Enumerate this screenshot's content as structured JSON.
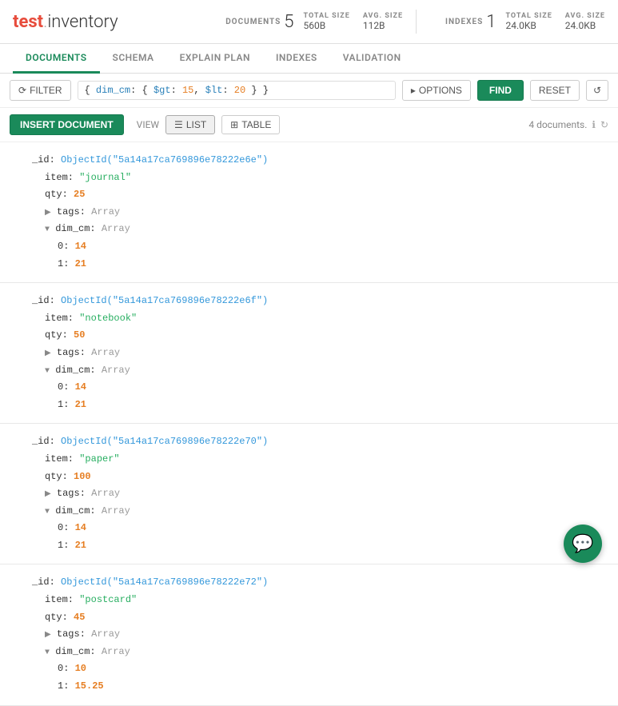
{
  "header": {
    "logo_test": "test",
    "logo_dot": ".",
    "logo_inventory": "inventory",
    "docs_label": "DOCUMENTS",
    "docs_count": "5",
    "docs_total_size_label": "TOTAL SIZE",
    "docs_total_size": "560B",
    "docs_avg_size_label": "AVG. SIZE",
    "docs_avg_size": "112B",
    "indexes_label": "INDEXES",
    "indexes_count": "1",
    "indexes_total_size_label": "TOTAL SIZE",
    "indexes_total_size": "24.0KB",
    "indexes_avg_size_label": "AVG. SIZE",
    "indexes_avg_size": "24.0KB"
  },
  "nav": {
    "tabs": [
      {
        "id": "documents",
        "label": "DOCUMENTS",
        "active": true
      },
      {
        "id": "schema",
        "label": "SCHEMA",
        "active": false
      },
      {
        "id": "explain-plan",
        "label": "EXPLAIN PLAN",
        "active": false
      },
      {
        "id": "indexes",
        "label": "INDEXES",
        "active": false
      },
      {
        "id": "validation",
        "label": "VALIDATION",
        "active": false
      }
    ]
  },
  "toolbar": {
    "filter_label": "FILTER",
    "filter_query": "{ dim_cm: { $gt: 15, $lt: 20 } }",
    "options_label": "▸ OPTIONS",
    "find_label": "FIND",
    "reset_label": "RESET"
  },
  "action_bar": {
    "insert_label": "INSERT DOCUMENT",
    "view_label": "VIEW",
    "list_label": "LIST",
    "table_label": "TABLE",
    "doc_count": "4 documents."
  },
  "documents": [
    {
      "id": "5a14a17ca769896e78222e6e",
      "item": "journal",
      "qty": "25",
      "tags_type": "Array",
      "dim_cm_type": "Array",
      "dim_0": "14",
      "dim_1": "21"
    },
    {
      "id": "5a14a17ca769896e78222e6f",
      "item": "notebook",
      "qty": "50",
      "tags_type": "Array",
      "dim_cm_type": "Array",
      "dim_0": "14",
      "dim_1": "21"
    },
    {
      "id": "5a14a17ca769896e78222e70",
      "item": "paper",
      "qty": "100",
      "tags_type": "Array",
      "dim_cm_type": "Array",
      "dim_0": "14",
      "dim_1": "21"
    },
    {
      "id": "5a14a17ca769896e78222e72",
      "item": "postcard",
      "qty": "45",
      "tags_type": "Array",
      "dim_cm_type": "Array",
      "dim_0": "10",
      "dim_1": "15.25"
    }
  ]
}
